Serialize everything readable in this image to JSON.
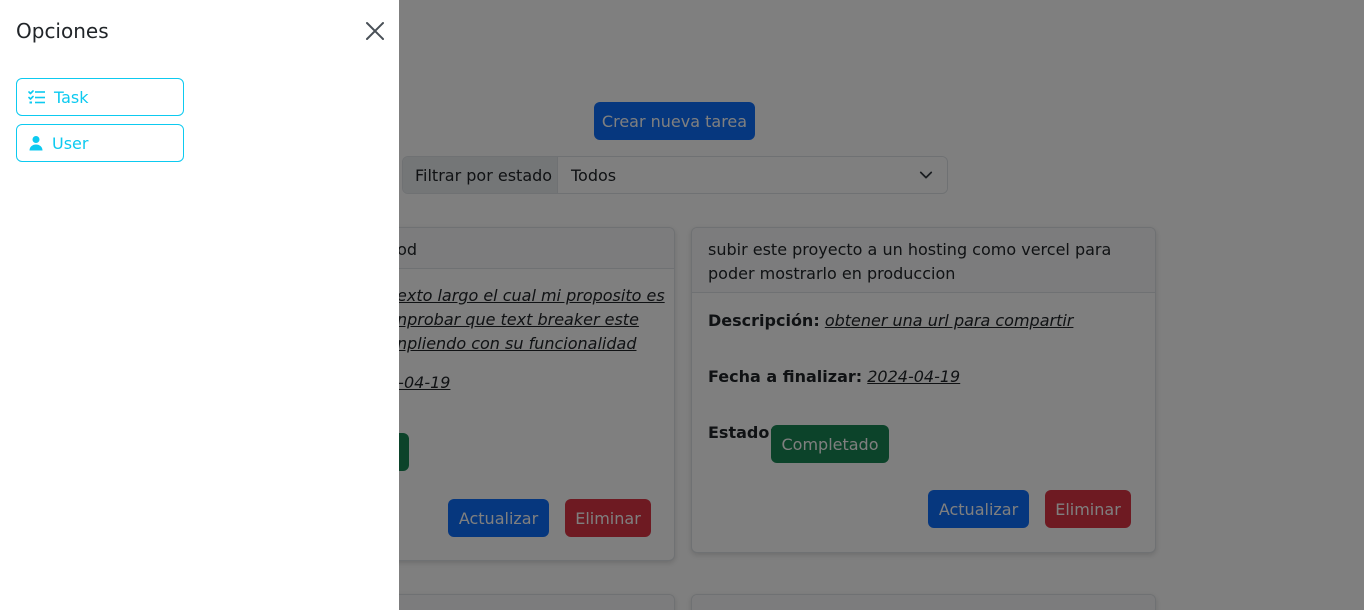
{
  "main": {
    "create_button": "Crear nueva tarea",
    "filter": {
      "label": "Filtrar por estado",
      "selected": "Todos"
    },
    "cards": [
      {
        "title": "nod",
        "description_lines": [
          "exto largo el cual mi proposito es",
          "nprobar que text breaker este",
          "npliendo con su funcionalidad"
        ],
        "date_fragment": "4-04-19",
        "update_label": "Actualizar",
        "delete_label": "Eliminar"
      },
      {
        "title": "subir este proyecto a un hosting como vercel para poder mostrarlo en produccion",
        "description_label": "Descripción:",
        "description": "obtener una url para compartir",
        "date_label": "Fecha a finalizar:",
        "date": "2024-04-19",
        "status_label": "Estado:",
        "status": "Completado",
        "update_label": "Actualizar",
        "delete_label": "Eliminar"
      }
    ]
  },
  "offcanvas": {
    "title": "Opciones",
    "options": [
      {
        "label": "Task",
        "icon": "list-check-icon"
      },
      {
        "label": "User",
        "icon": "person-icon"
      }
    ]
  },
  "colors": {
    "primary": "#0d6efd",
    "danger": "#dc3545",
    "success": "#198754",
    "info": "#0dcaf0"
  }
}
